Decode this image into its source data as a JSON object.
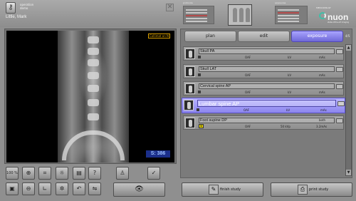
{
  "header": {
    "operator_label": "operation demo",
    "patient_name": "Little, Mark",
    "thumbnails": [
      {
        "label": "protocols",
        "selected": false
      },
      {
        "label": "",
        "selected": true
      },
      {
        "label": "exposures",
        "selected": false
      }
    ],
    "logo": {
      "brand": "MEDCONSULT",
      "name": "nuon",
      "tagline": "state-of-the-art imaging"
    }
  },
  "viewer": {
    "collimation_label": "Collimat on N",
    "s_value": "S: 386"
  },
  "toolbar": {
    "row1": [
      {
        "name": "zoom-100-button",
        "label": "100 %",
        "icon": "text"
      },
      {
        "name": "zoom-in-button",
        "label": "⊕",
        "icon": "magnifier-plus-icon"
      },
      {
        "name": "crop-button",
        "label": "⌗",
        "icon": "crop-icon"
      },
      {
        "name": "brightness-button",
        "label": "☼",
        "icon": "sun-icon"
      },
      {
        "name": "print-preview-button",
        "label": "▤",
        "icon": "print-icon"
      },
      {
        "name": "annotation-button",
        "label": "?",
        "icon": "question-icon"
      },
      {
        "name": "body-region-button",
        "label": "♙",
        "icon": "body-icon"
      },
      {
        "name": "accept-button",
        "label": "✓",
        "icon": "checkmark-icon"
      }
    ],
    "row2": [
      {
        "name": "fit-window-button",
        "label": "▣",
        "icon": "fit-icon"
      },
      {
        "name": "zoom-out-button",
        "label": "⊖",
        "icon": "magnifier-minus-icon"
      },
      {
        "name": "measure-button",
        "label": "∟",
        "icon": "ruler-icon"
      },
      {
        "name": "contrast-button",
        "label": "✲",
        "icon": "contrast-icon"
      },
      {
        "name": "rotate-button",
        "label": "↶",
        "icon": "rotate-icon"
      },
      {
        "name": "flip-button",
        "label": "⇋",
        "icon": "flip-icon"
      }
    ],
    "eye_label": "👁"
  },
  "tabs": [
    {
      "label": "plan",
      "active": false
    },
    {
      "label": "edit",
      "active": false
    },
    {
      "label": "exposure",
      "active": true
    }
  ],
  "exposure_count": "4/5",
  "exposures": [
    {
      "name": "Skull PA",
      "active": false,
      "params": [
        "OAF",
        "kV",
        "mAs"
      ],
      "extra": ""
    },
    {
      "name": "Skull LAT",
      "active": false,
      "params": [
        "OAF",
        "kV",
        "mAs"
      ],
      "extra": ""
    },
    {
      "name": "Cervical spine AP",
      "active": false,
      "params": [
        "OAF",
        "kV",
        "mAs"
      ],
      "extra": ""
    },
    {
      "name": "Lumbar spine AP",
      "active": true,
      "params": [
        "OAF",
        "kV",
        "mAs"
      ],
      "extra": ""
    },
    {
      "name": "Foot supine DP",
      "active": false,
      "params": [
        "OAF",
        "50 kVp",
        "3.2mAs"
      ],
      "extra": "both"
    }
  ],
  "bottom": {
    "finish_label": "finish study",
    "print_label": "print study"
  },
  "colors": {
    "active_tab": "#8a84f0",
    "active_row": "#a9a3fb",
    "panel_bg": "#8f8f8f",
    "s_value_bg": "#1b2f8a"
  }
}
